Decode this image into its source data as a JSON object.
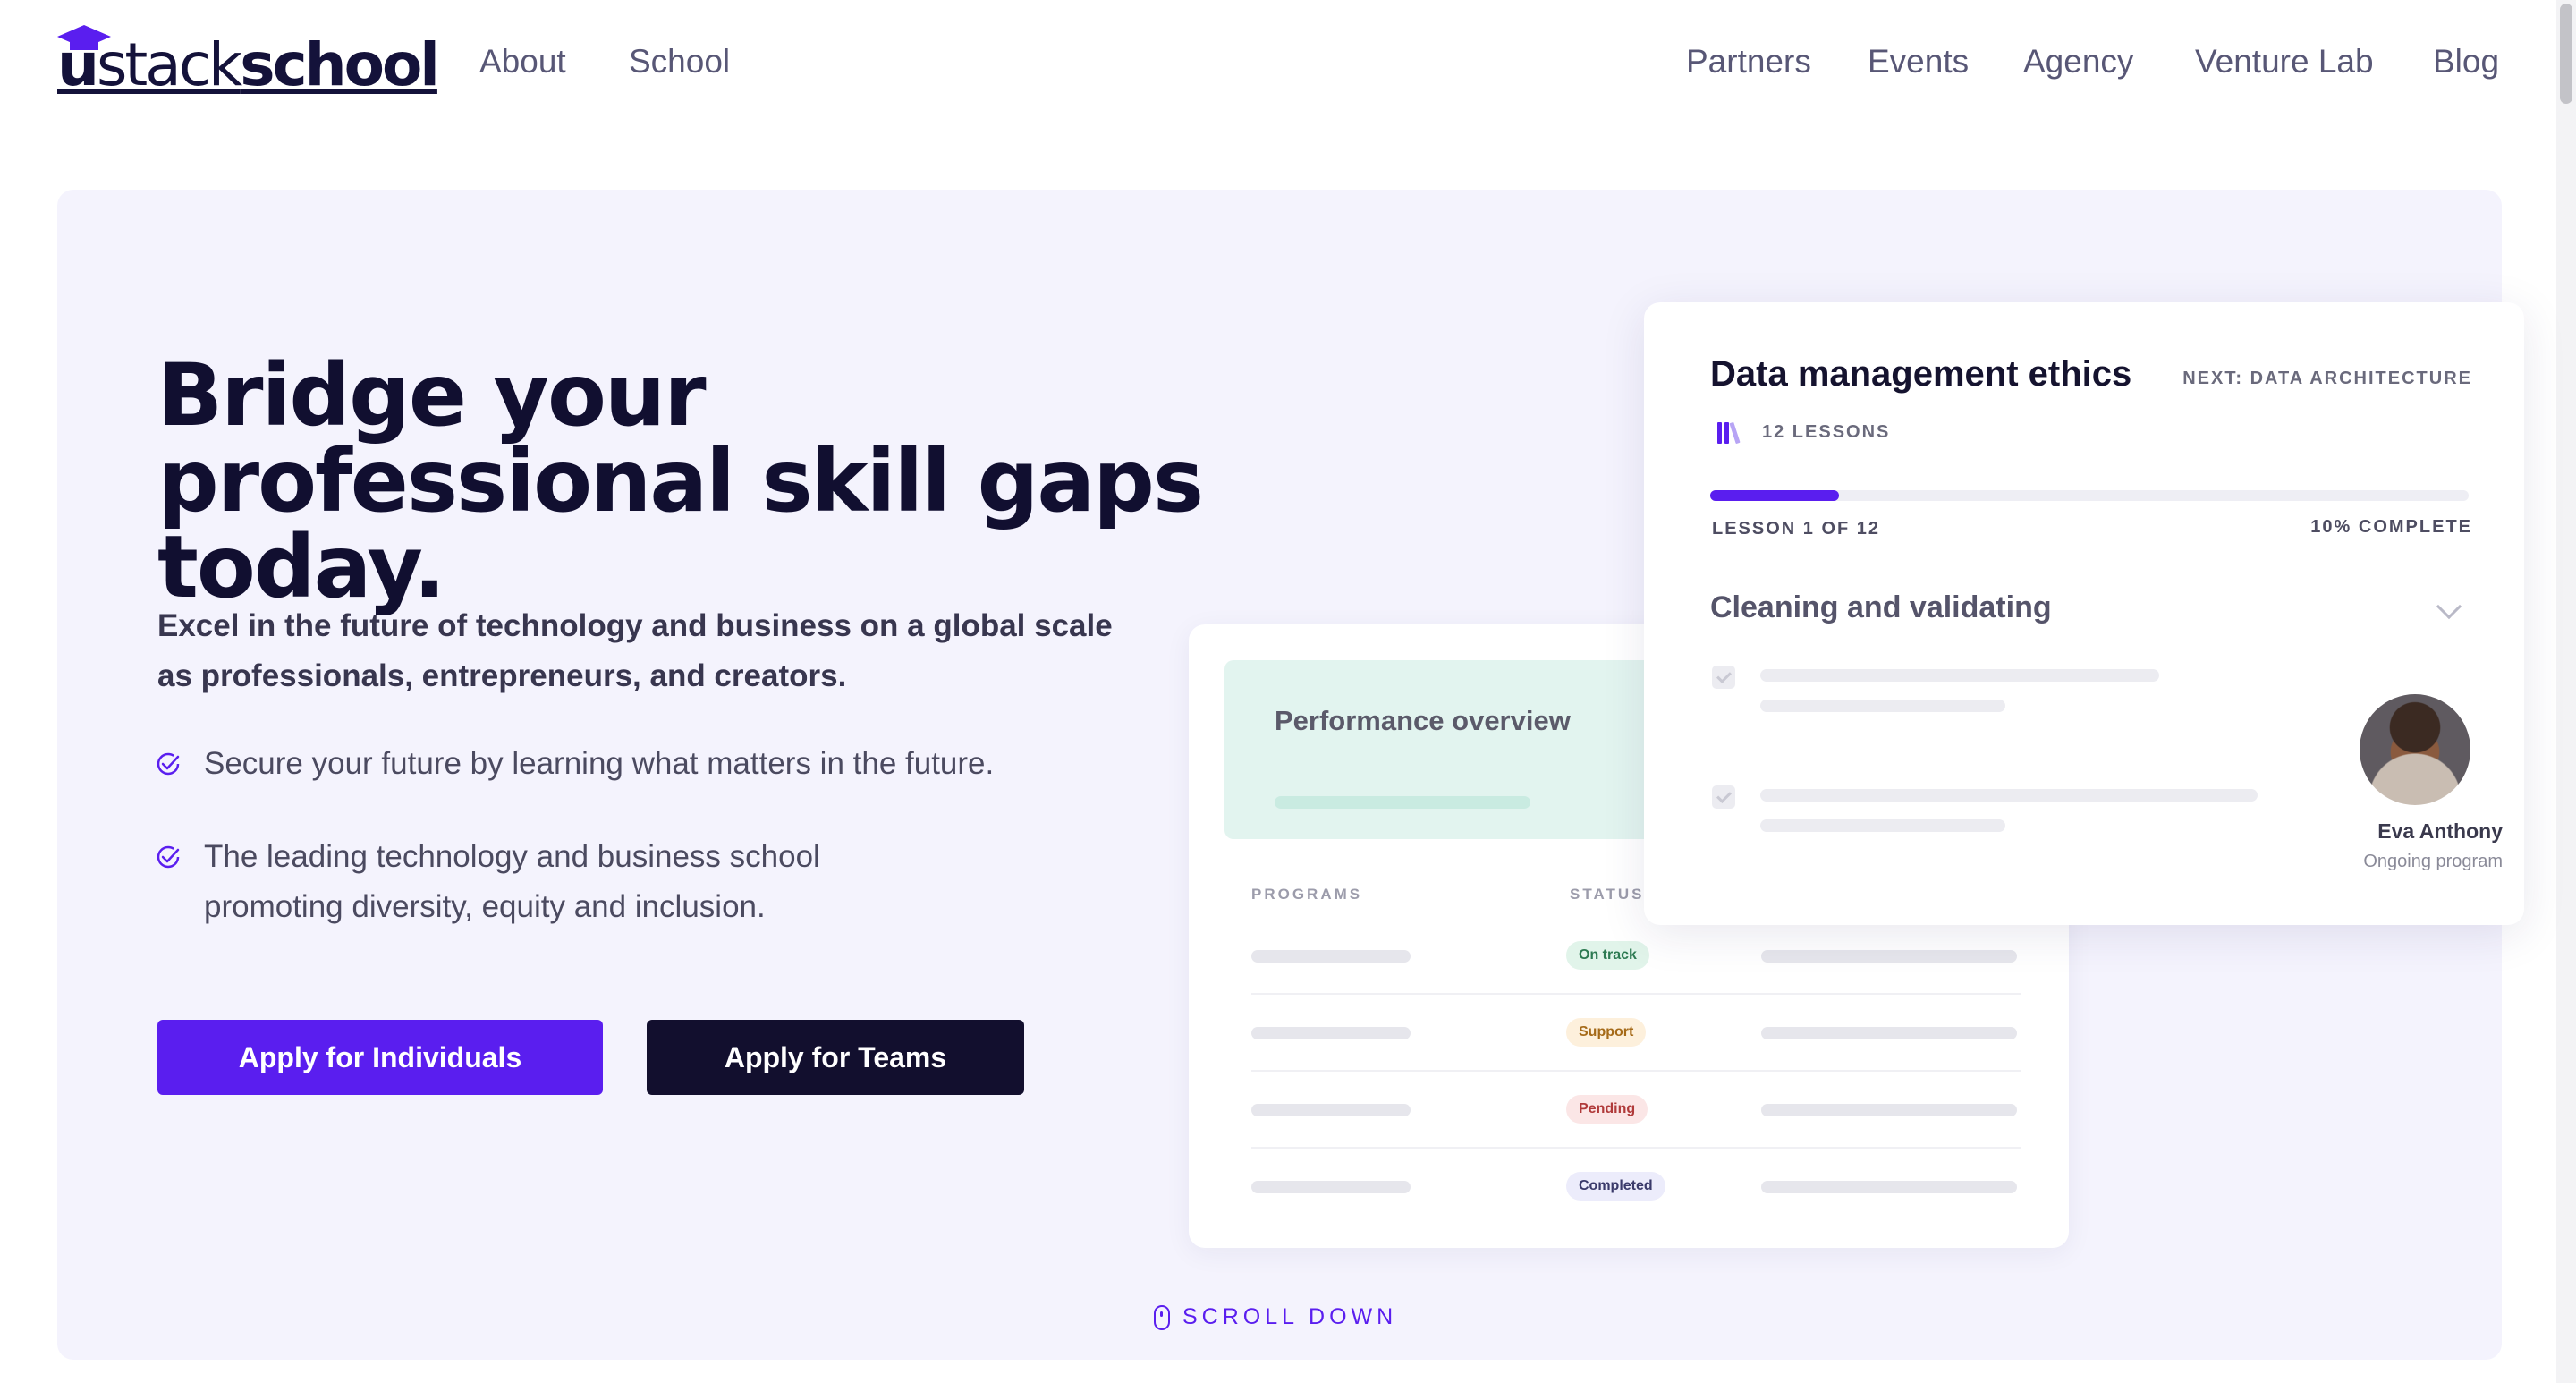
{
  "header": {
    "logo_prefix": "u",
    "logo_brand": "stack",
    "logo_suffix": "school",
    "nav_left": [
      "About",
      "School"
    ],
    "nav_right": [
      "Partners",
      "Events",
      "Agency",
      "Venture Lab",
      "Blog"
    ]
  },
  "hero": {
    "headline": "Bridge your professional skill gaps today.",
    "subhead": "Excel in the future of technology and business on a global scale as professionals, entrepreneurs, and creators.",
    "checks": [
      "Secure your future by learning what matters in the future.",
      "The leading technology and business school promoting diversity, equity and inclusion."
    ],
    "apply_individuals": "Apply for Individuals",
    "apply_teams": "Apply for Teams",
    "scroll_down": "SCROLL DOWN"
  },
  "table_card": {
    "title": "Performance overview",
    "columns": [
      "PROGRAMS",
      "STATUS"
    ],
    "statuses": [
      {
        "label": "On track",
        "bg": "#e1f4ea",
        "fg": "#2d7a52"
      },
      {
        "label": "Support",
        "bg": "#fdf0dc",
        "fg": "#a56a18"
      },
      {
        "label": "Pending",
        "bg": "#fbe6e6",
        "fg": "#b03a3a"
      },
      {
        "label": "Completed",
        "bg": "#ececfb",
        "fg": "#3a3a6a"
      }
    ]
  },
  "course_card": {
    "title": "Data management ethics",
    "next": "NEXT: DATA ARCHITECTURE",
    "lessons": "12 LESSONS",
    "lesson_of": "LESSON 1 OF 12",
    "percent": "10% COMPLETE",
    "progress": 0.1,
    "section": "Cleaning and validating",
    "person_name": "Eva Anthony",
    "person_status": "Ongoing program"
  },
  "colors": {
    "accent": "#5a1eef",
    "dark": "#120f2e",
    "hero_bg": "#f4f3fd"
  }
}
